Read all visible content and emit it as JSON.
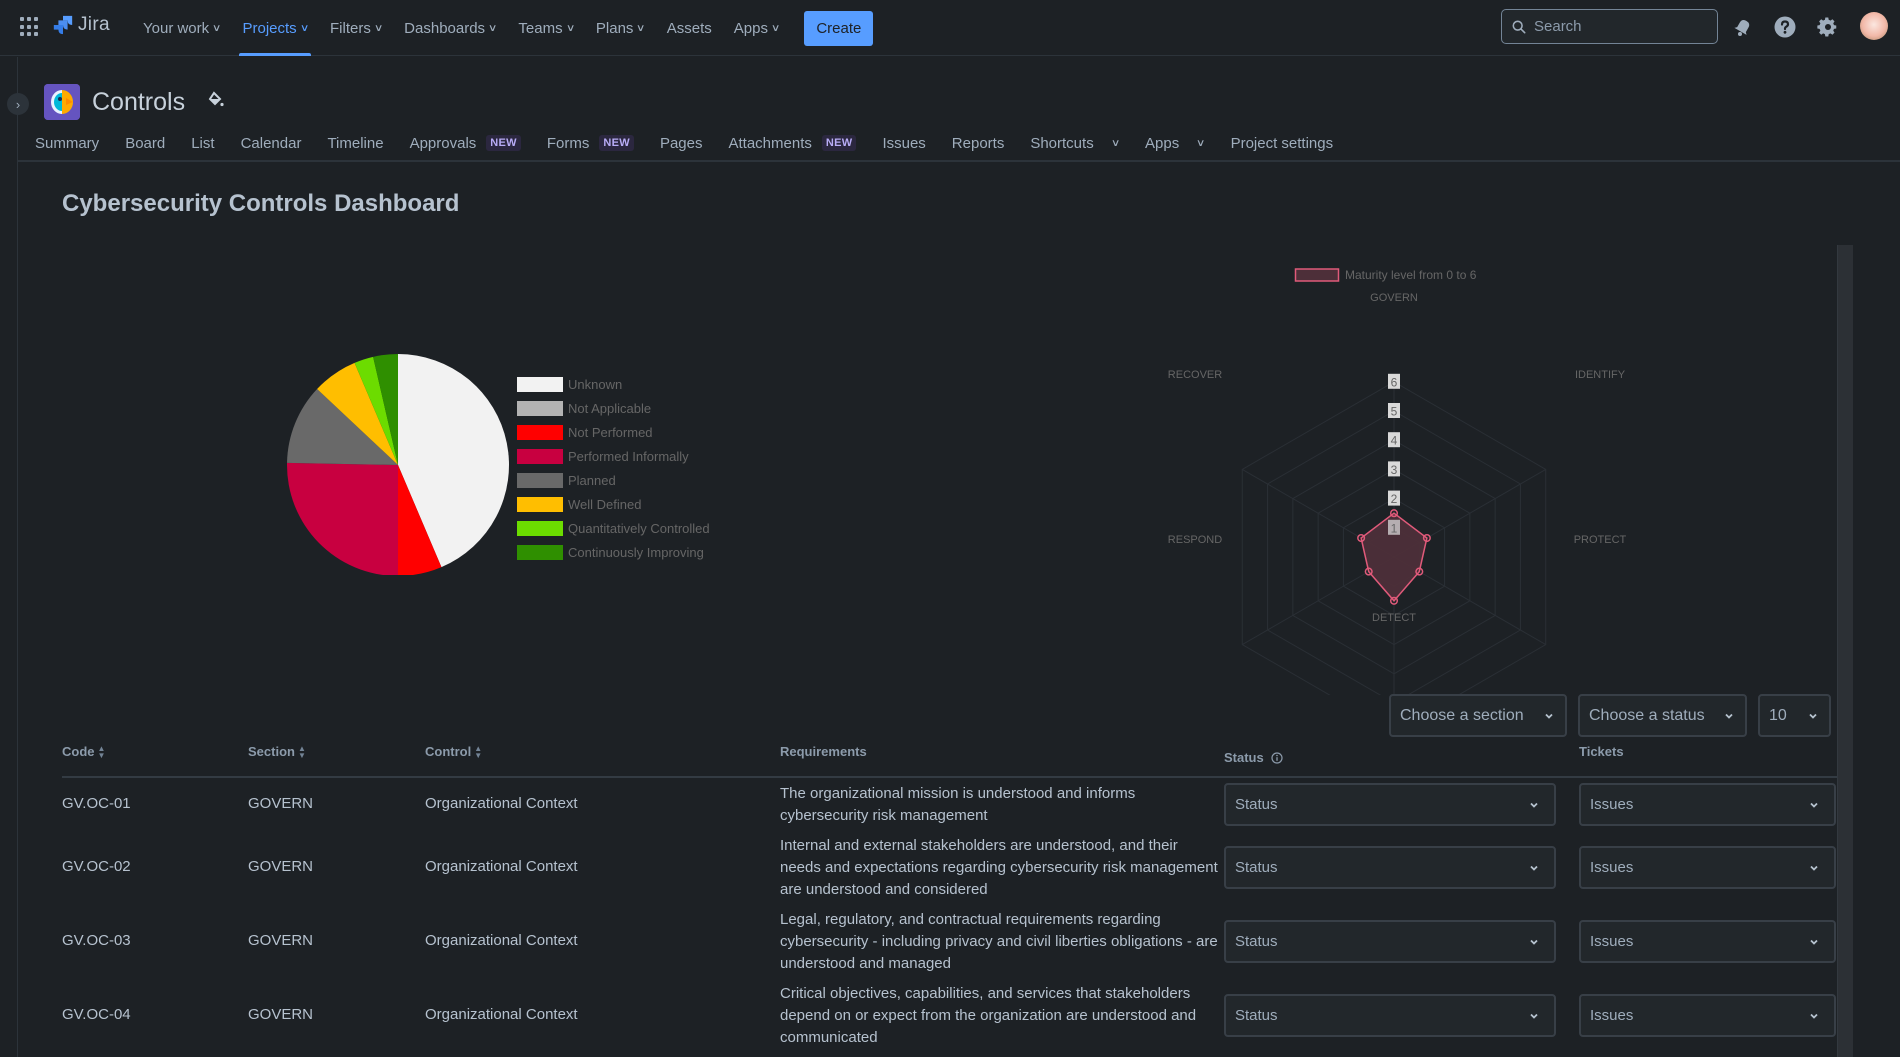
{
  "topnav": {
    "logo": "Jira",
    "items": [
      {
        "label": "Your work",
        "dropdown": true,
        "active": false
      },
      {
        "label": "Projects",
        "dropdown": true,
        "active": true
      },
      {
        "label": "Filters",
        "dropdown": true,
        "active": false
      },
      {
        "label": "Dashboards",
        "dropdown": true,
        "active": false
      },
      {
        "label": "Teams",
        "dropdown": true,
        "active": false
      },
      {
        "label": "Plans",
        "dropdown": true,
        "active": false
      },
      {
        "label": "Assets",
        "dropdown": false,
        "active": false
      },
      {
        "label": "Apps",
        "dropdown": true,
        "active": false
      }
    ],
    "create_label": "Create",
    "search_placeholder": "Search",
    "accent_color": "#579dff"
  },
  "project": {
    "name": "Controls",
    "tabs": [
      {
        "label": "Summary",
        "badge": null,
        "dropdown": false
      },
      {
        "label": "Board",
        "badge": null,
        "dropdown": false
      },
      {
        "label": "List",
        "badge": null,
        "dropdown": false
      },
      {
        "label": "Calendar",
        "badge": null,
        "dropdown": false
      },
      {
        "label": "Timeline",
        "badge": null,
        "dropdown": false
      },
      {
        "label": "Approvals",
        "badge": "NEW",
        "dropdown": false
      },
      {
        "label": "Forms",
        "badge": "NEW",
        "dropdown": false
      },
      {
        "label": "Pages",
        "badge": null,
        "dropdown": false
      },
      {
        "label": "Attachments",
        "badge": "NEW",
        "dropdown": false
      },
      {
        "label": "Issues",
        "badge": null,
        "dropdown": false
      },
      {
        "label": "Reports",
        "badge": null,
        "dropdown": false
      },
      {
        "label": "Shortcuts",
        "badge": null,
        "dropdown": true
      },
      {
        "label": "Apps",
        "badge": null,
        "dropdown": true
      },
      {
        "label": "Project settings",
        "badge": null,
        "dropdown": false
      }
    ]
  },
  "page": {
    "title": "Cybersecurity Controls Dashboard"
  },
  "chart_data": [
    {
      "type": "pie",
      "title": "",
      "legend_position": "right",
      "categories": [
        "Unknown",
        "Not Applicable",
        "Not Performed",
        "Performed Informally",
        "Planned",
        "Well Defined",
        "Quantitatively Controlled",
        "Continuously Improving"
      ],
      "values_percent": [
        43.6,
        0,
        6.4,
        25.3,
        11.7,
        6.6,
        2.8,
        3.6
      ],
      "colors": [
        "#f2f2f2",
        "#b3b3b3",
        "#ff0000",
        "#c80040",
        "#696969",
        "#ffbe00",
        "#6cdc00",
        "#2f8f00"
      ]
    },
    {
      "type": "radar",
      "title": "",
      "legend": [
        "Maturity level from 0 to 6"
      ],
      "legend_position": "top",
      "axes": [
        "GOVERN",
        "IDENTIFY",
        "PROTECT",
        "DETECT",
        "RESPOND",
        "RECOVER"
      ],
      "range": [
        0,
        6
      ],
      "ticks": [
        1,
        2,
        3,
        4,
        5,
        6
      ],
      "series": [
        {
          "name": "Maturity level from 0 to 6",
          "values": [
            1.5,
            1.3,
            1.0,
            1.5,
            1.0,
            1.3
          ],
          "color": "#e05a7a",
          "fill": "#4d2f39"
        }
      ],
      "grid": true
    }
  ],
  "filters": {
    "section": "Choose a section",
    "status": "Choose a status",
    "page_size": "10"
  },
  "table": {
    "columns": [
      {
        "label": "Code",
        "sortable": true
      },
      {
        "label": "Section",
        "sortable": true
      },
      {
        "label": "Control",
        "sortable": true
      },
      {
        "label": "Requirements",
        "sortable": false
      },
      {
        "label": "Status",
        "sortable": false,
        "info": true
      },
      {
        "label": "Tickets",
        "sortable": false
      }
    ],
    "rows": [
      {
        "code": "GV.OC-01",
        "section": "GOVERN",
        "control": "Organizational Context",
        "requirements": "The organizational mission is understood and informs cybersecurity risk management",
        "status": "Status",
        "tickets": "Issues"
      },
      {
        "code": "GV.OC-02",
        "section": "GOVERN",
        "control": "Organizational Context",
        "requirements": "Internal and external stakeholders are understood, and their needs and expectations regarding cybersecurity risk management are understood and considered",
        "status": "Status",
        "tickets": "Issues"
      },
      {
        "code": "GV.OC-03",
        "section": "GOVERN",
        "control": "Organizational Context",
        "requirements": "Legal, regulatory, and contractual requirements regarding cybersecurity - including privacy and civil liberties obligations - are understood and managed",
        "status": "Status",
        "tickets": "Issues"
      },
      {
        "code": "GV.OC-04",
        "section": "GOVERN",
        "control": "Organizational Context",
        "requirements": "Critical objectives, capabilities, and services that stakeholders depend on or expect from the organization are understood and communicated",
        "status": "Status",
        "tickets": "Issues"
      }
    ]
  }
}
